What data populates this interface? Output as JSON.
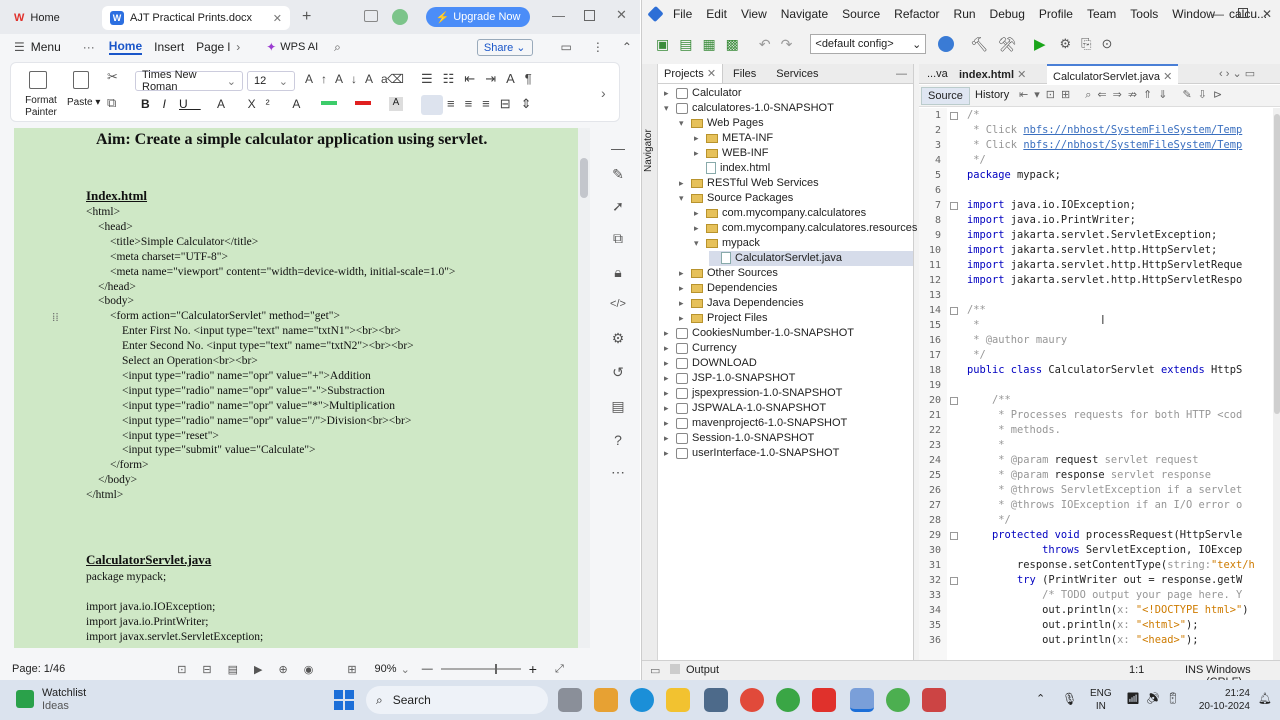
{
  "wps": {
    "tabs": {
      "home": "Home",
      "doc": "AJT Practical Prints.docx",
      "upgrade": "Upgrade Now"
    },
    "menu": {
      "menu": "Menu",
      "home": "Home",
      "insert": "Insert",
      "page": "Page l",
      "wps_ai": "WPS AI",
      "share": "Share"
    },
    "ribbon": {
      "format_painter_1": "Format",
      "format_painter_2": "Painter",
      "paste": "Paste",
      "font": "Times New Roman",
      "size": "12"
    },
    "doc": {
      "aim": "Aim: Create a simple calculator application using servlet.",
      "h1": "Index.html",
      "lines": [
        "<html>",
        "<head>",
        "<title>Simple Calculator</title>",
        "<meta charset=\"UTF-8\">",
        "<meta name=\"viewport\" content=\"width=device-width, initial-scale=1.0\">",
        "</head>",
        "<body>",
        "<form action=\"CalculatorServlet\" method=\"get\">",
        "Enter First No. <input type=\"text\" name=\"txtN1\"><br><br>",
        "Enter Second No. <input type=\"text\" name=\"txtN2\"><br><br>",
        "Select an Operation<br><br>",
        "<input type=\"radio\" name=\"opr\" value=\"+\">Addition",
        "<input type=\"radio\" name=\"opr\" value=\"-\">Substraction",
        "<input type=\"radio\" name=\"opr\" value=\"*\">Multiplication",
        "<input type=\"radio\" name=\"opr\" value=\"/\">Division<br><br>",
        "<input type=\"reset\">",
        "<input type=\"submit\" value=\"Calculate\">",
        "</form>",
        "</body>",
        "</html>"
      ],
      "h2": "CalculatorServlet.java",
      "lines2": [
        "package mypack;",
        "",
        "import java.io.IOException;",
        "import java.io.PrintWriter;",
        "import javax.servlet.ServletException;"
      ]
    },
    "status": {
      "page": "Page: 1/46",
      "zoom": "90%"
    }
  },
  "nb": {
    "menu": [
      "File",
      "Edit",
      "View",
      "Navigate",
      "Source",
      "Refactor",
      "Run",
      "Debug",
      "Profile",
      "Team",
      "Tools",
      "Window",
      "calcu..."
    ],
    "config": "<default config>",
    "panel_tabs": [
      "Projects",
      "Files",
      "Services"
    ],
    "navigator": "Navigator",
    "tree": [
      {
        "t": "Calculator",
        "d": 0,
        "k": "proj",
        "a": "▸"
      },
      {
        "t": "calculatores-1.0-SNAPSHOT",
        "d": 0,
        "k": "proj",
        "a": "▾"
      },
      {
        "t": "Web Pages",
        "d": 1,
        "k": "fold",
        "a": "▾"
      },
      {
        "t": "META-INF",
        "d": 2,
        "k": "fold",
        "a": "▸"
      },
      {
        "t": "WEB-INF",
        "d": 2,
        "k": "fold",
        "a": "▸"
      },
      {
        "t": "index.html",
        "d": 2,
        "k": "file",
        "a": ""
      },
      {
        "t": "RESTful Web Services",
        "d": 1,
        "k": "fold",
        "a": "▸"
      },
      {
        "t": "Source Packages",
        "d": 1,
        "k": "fold",
        "a": "▾"
      },
      {
        "t": "com.mycompany.calculatores",
        "d": 2,
        "k": "fold",
        "a": "▸"
      },
      {
        "t": "com.mycompany.calculatores.resources",
        "d": 2,
        "k": "fold",
        "a": "▸"
      },
      {
        "t": "mypack",
        "d": 2,
        "k": "fold",
        "a": "▾"
      },
      {
        "t": "CalculatorServlet.java",
        "d": 3,
        "k": "file",
        "a": "",
        "sel": true
      },
      {
        "t": "Other Sources",
        "d": 1,
        "k": "fold",
        "a": "▸"
      },
      {
        "t": "Dependencies",
        "d": 1,
        "k": "fold",
        "a": "▸"
      },
      {
        "t": "Java Dependencies",
        "d": 1,
        "k": "fold",
        "a": "▸"
      },
      {
        "t": "Project Files",
        "d": 1,
        "k": "fold",
        "a": "▸"
      },
      {
        "t": "CookiesNumber-1.0-SNAPSHOT",
        "d": 0,
        "k": "proj",
        "a": "▸"
      },
      {
        "t": "Currency",
        "d": 0,
        "k": "proj",
        "a": "▸"
      },
      {
        "t": "DOWNLOAD",
        "d": 0,
        "k": "proj",
        "a": "▸"
      },
      {
        "t": "JSP-1.0-SNAPSHOT",
        "d": 0,
        "k": "proj",
        "a": "▸"
      },
      {
        "t": "jspexpression-1.0-SNAPSHOT",
        "d": 0,
        "k": "proj",
        "a": "▸"
      },
      {
        "t": "JSPWALA-1.0-SNAPSHOT",
        "d": 0,
        "k": "proj",
        "a": "▸"
      },
      {
        "t": "mavenproject6-1.0-SNAPSHOT",
        "d": 0,
        "k": "proj",
        "a": "▸"
      },
      {
        "t": "Session-1.0-SNAPSHOT",
        "d": 0,
        "k": "proj",
        "a": "▸"
      },
      {
        "t": "userInterface-1.0-SNAPSHOT",
        "d": 0,
        "k": "proj",
        "a": "▸"
      }
    ],
    "editor_tabs": [
      "...va",
      "index.html",
      "CalculatorServlet.java"
    ],
    "source": "Source",
    "history": "History",
    "line_numbers": [
      "1",
      "2",
      "3",
      "4",
      "5",
      "6",
      "7",
      "8",
      "9",
      "10",
      "11",
      "12",
      "13",
      "14",
      "15",
      "16",
      "17",
      "18",
      "19",
      "20",
      "21",
      "22",
      "23",
      "24",
      "25",
      "26",
      "27",
      "28",
      "29",
      "30",
      "31",
      "32",
      "33",
      "34",
      "35",
      "36"
    ],
    "code": [
      [
        [
          "cm",
          "/*"
        ]
      ],
      [
        [
          "cm",
          " * Click "
        ],
        [
          "lk",
          "nbfs://nbhost/SystemFileSystem/Temp"
        ]
      ],
      [
        [
          "cm",
          " * Click "
        ],
        [
          "lk",
          "nbfs://nbhost/SystemFileSystem/Temp"
        ]
      ],
      [
        [
          "cm",
          " */"
        ]
      ],
      [
        [
          "kw",
          "package "
        ],
        [
          "",
          "mypack;"
        ]
      ],
      [
        [
          "",
          ""
        ]
      ],
      [
        [
          "kw",
          "import "
        ],
        [
          "",
          "java.io.IOException;"
        ]
      ],
      [
        [
          "kw",
          "import "
        ],
        [
          "",
          "java.io.PrintWriter;"
        ]
      ],
      [
        [
          "kw",
          "import "
        ],
        [
          "",
          "jakarta.servlet.ServletException;"
        ]
      ],
      [
        [
          "kw",
          "import "
        ],
        [
          "",
          "jakarta.servlet.http.HttpServlet;"
        ]
      ],
      [
        [
          "kw",
          "import "
        ],
        [
          "",
          "jakarta.servlet.http.HttpServletReque"
        ]
      ],
      [
        [
          "kw",
          "import "
        ],
        [
          "",
          "jakarta.servlet.http.HttpServletRespo"
        ]
      ],
      [
        [
          "",
          ""
        ]
      ],
      [
        [
          "cm",
          "/**"
        ]
      ],
      [
        [
          "cm",
          " *"
        ]
      ],
      [
        [
          "cm",
          " * @author maury"
        ]
      ],
      [
        [
          "cm",
          " */"
        ]
      ],
      [
        [
          "kw",
          "public class "
        ],
        [
          "",
          "CalculatorServlet "
        ],
        [
          "kw",
          "extends "
        ],
        [
          "",
          "HttpS"
        ]
      ],
      [
        [
          "",
          ""
        ]
      ],
      [
        [
          "cm",
          "    /**"
        ]
      ],
      [
        [
          "cm",
          "     * Processes requests for both HTTP <cod"
        ]
      ],
      [
        [
          "cm",
          "     * methods."
        ]
      ],
      [
        [
          "cm",
          "     *"
        ]
      ],
      [
        [
          "cm",
          "     * @param "
        ],
        [
          "",
          "request "
        ],
        [
          "cm",
          "servlet request"
        ]
      ],
      [
        [
          "cm",
          "     * @param "
        ],
        [
          "",
          "response "
        ],
        [
          "cm",
          "servlet response"
        ]
      ],
      [
        [
          "cm",
          "     * @throws ServletException if a servlet"
        ]
      ],
      [
        [
          "cm",
          "     * @throws IOException if an I/O error o"
        ]
      ],
      [
        [
          "cm",
          "     */"
        ]
      ],
      [
        [
          "kw",
          "    protected void "
        ],
        [
          "",
          "processRequest(HttpServle"
        ]
      ],
      [
        [
          "kw",
          "            throws "
        ],
        [
          "",
          "ServletException, IOExcep"
        ]
      ],
      [
        [
          "",
          "        response.setContentType("
        ],
        [
          "cm",
          "string:"
        ],
        [
          "st",
          "\"text/h"
        ]
      ],
      [
        [
          "kw",
          "        try "
        ],
        [
          "",
          "(PrintWriter out = response.getW"
        ]
      ],
      [
        [
          "cm",
          "            /* TODO output your page here. Y"
        ]
      ],
      [
        [
          "",
          "            out.println("
        ],
        [
          "cm",
          "x: "
        ],
        [
          "st",
          "\"<!DOCTYPE html>\""
        ],
        [
          "",
          ")"
        ]
      ],
      [
        [
          "",
          "            out.println("
        ],
        [
          "cm",
          "x: "
        ],
        [
          "st",
          "\"<html>\""
        ],
        [
          "",
          ");"
        ]
      ],
      [
        [
          "",
          "            out.println("
        ],
        [
          "cm",
          "x: "
        ],
        [
          "st",
          "\"<head>\""
        ],
        [
          "",
          ");"
        ]
      ]
    ],
    "output": "Output",
    "status": {
      "pos": "1:1",
      "ins": "INS",
      "enc": "Windows (CRLF)"
    }
  },
  "taskbar": {
    "watch1": "Watchlist",
    "watch2": "Ideas",
    "search": "Search",
    "lang1": "ENG",
    "lang2": "IN",
    "time": "21:24",
    "date": "20-10-2024"
  }
}
